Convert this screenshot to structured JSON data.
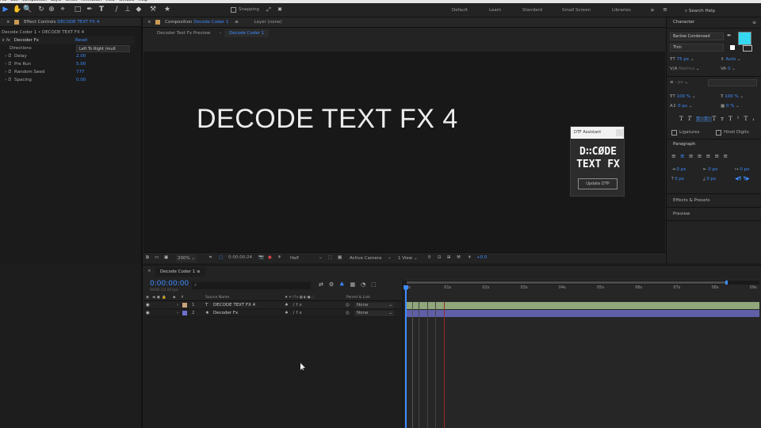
{
  "menu": [
    "File",
    "Edit",
    "Composition",
    "Layer",
    "Effect",
    "Animation",
    "View",
    "Window",
    "Help"
  ],
  "toolbar": {
    "snapping_label": "Snapping"
  },
  "workspaces": [
    "Default",
    "Learn",
    "Standard",
    "Small Screen",
    "Libraries"
  ],
  "search_help": "Search Help",
  "effect_controls": {
    "tab_label": "Effect Controls",
    "tab_target": "DECODE TEXT FX 4",
    "header": "Decode Coder 1 • DECODE TEXT FX 4",
    "effect_name": "Decoder Fx",
    "reset_label": "Reset",
    "directions_label": "Directions",
    "directions_value": "Left To Right (mult",
    "params": [
      {
        "name": "Delay",
        "value": "2.00"
      },
      {
        "name": "Pre Run",
        "value": "5.00"
      },
      {
        "name": "Random Seed",
        "value": "777"
      },
      {
        "name": "Spacing",
        "value": "0.00"
      }
    ]
  },
  "composition": {
    "tab_label": "Composition",
    "tab_target": "Decode Coder 1",
    "layer_tab": "Layer (none)",
    "crumbs": [
      "Decoder Text Fx Preview",
      "Decode Coder 1"
    ],
    "title_text": "DECODE TEXT FX 4",
    "zoom": "200%",
    "timecode": "0:00:00:24",
    "resolution": "Half",
    "camera": "Active Camera",
    "view": "1 View",
    "exposure": "+0.0"
  },
  "dtf": {
    "header": "DTF Assistant",
    "logo_line1": "D∷CØDE",
    "logo_line2": "TEXT FX",
    "button": "Update DTP"
  },
  "character": {
    "title": "Character",
    "font": "Barlow Condensed",
    "style": "Thin",
    "size": "75 px",
    "leading": "Auto",
    "kerning": "Metrics",
    "tracking": "0",
    "stroke": "- px",
    "vscale": "100 %",
    "hscale": "100 %",
    "baseline": "0 px",
    "tsume": "0 %",
    "ligatures": "Ligatures",
    "hindi": "Hindi Digits",
    "paragraph": "Paragraph",
    "para_vals": [
      "0 px",
      "0 px",
      "0 px",
      "0 px",
      "0 px"
    ],
    "effects_presets": "Effects & Presets",
    "preview": "Preview",
    "accent": "#35d8f0"
  },
  "timeline": {
    "tab_label": "Decode Coder 1",
    "timecode": "0:00:00:00",
    "fps": "00000 (24.00 fps)",
    "col_source": "Source Name",
    "col_parent": "Parent & Link",
    "layers": [
      {
        "num": "1",
        "type": "T",
        "name": "DECODE TEXT FX 4",
        "parent": "None",
        "color": "#c9a37a",
        "bar": "#8fa77a"
      },
      {
        "num": "2",
        "type": "★",
        "name": "Decoder Fx",
        "parent": "None",
        "color": "#6d6fd1",
        "bar": "#5f5fa8"
      }
    ],
    "ticks": [
      "0s",
      "01s",
      "02s",
      "03s",
      "04s",
      "05s",
      "06s",
      "07s",
      "08s",
      "09s"
    ]
  }
}
